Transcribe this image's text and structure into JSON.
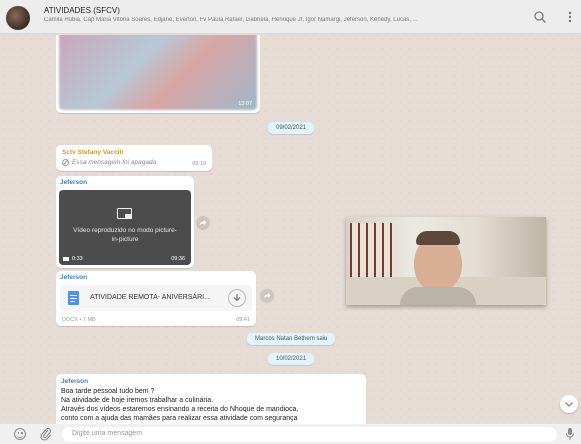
{
  "header": {
    "title": "ATIVIDADES (SFCV)",
    "members": "Camila Rubia, Cap Maria Vitória Soares, Edjane, Everton, Fv Paula Rafael, Gabriela, Henrique Jf, Igor Namargi, Jeferson, Kenedy, Lucas, ..."
  },
  "messages": {
    "first_image_time": "13:07",
    "date_1": "09/02/2021",
    "deleted": {
      "sender": "Sctv Stefany Vaccili",
      "text": "Essa mensagem foi apagada",
      "time": "08:10"
    },
    "video": {
      "sender": "Jeferson",
      "pip_text": "Vídeo reproduzido no modo picture-in-picture",
      "duration": "0:33",
      "time": "09:36"
    },
    "document": {
      "sender": "Jeferson",
      "filename": "ATIVIDADE REMOTA- ANIVERSÁRI...",
      "meta": "DOCX • 7 MB",
      "time": "09:41"
    },
    "system_left": "Marcos Natan Bethem saiu",
    "date_2": "10/02/2021",
    "text_msg": {
      "sender": "Jeferson",
      "lines": [
        "Boa tarde pessoal tudo bem ?",
        "Na atividade de hoje iremos trabalhar a culinária.",
        "Através dos vídeos estaremos ensinando a receita do Nhoque de mandioca,",
        "conto com a ajuda das mamães para realizar essa atividade com segurança"
      ]
    }
  },
  "footer": {
    "placeholder": "Digite uma mensagem"
  },
  "icons": [
    "search-icon",
    "menu-icon",
    "emoji-icon",
    "attach-icon",
    "mic-icon",
    "forward-icon",
    "download-icon",
    "document-icon",
    "video-icon",
    "scroll-down-icon",
    "deleted-icon"
  ]
}
